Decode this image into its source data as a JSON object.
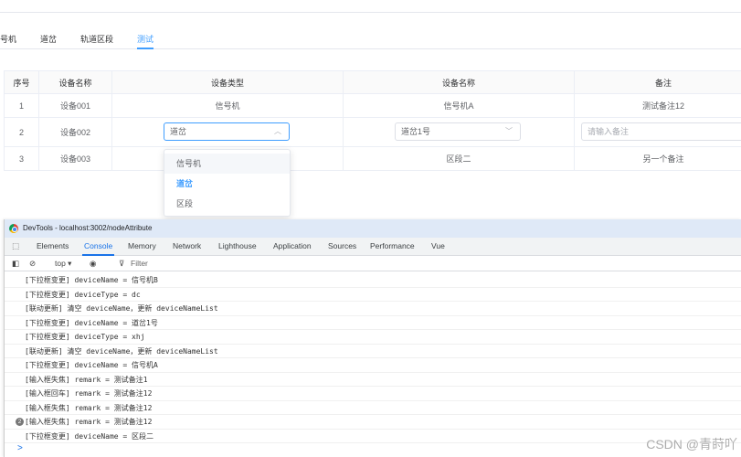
{
  "tabs": [
    "号机",
    "道岔",
    "轨道区段",
    "测试"
  ],
  "table": {
    "headers": [
      "序号",
      "设备名称",
      "设备类型",
      "设备名称",
      "备注"
    ],
    "rows": [
      {
        "index": "1",
        "name": "设备001",
        "type": "信号机",
        "device_name": "信号机A",
        "remark": "测试备注12"
      },
      {
        "index": "2",
        "name": "设备002",
        "type": "道岔",
        "device_name": "道岔1号",
        "remark_placeholder": "请输入备注"
      },
      {
        "index": "3",
        "name": "设备003",
        "type": "",
        "device_name": "区段二",
        "remark": "另一个备注"
      }
    ]
  },
  "dropdown": {
    "options": [
      "信号机",
      "道岔",
      "区段"
    ],
    "selected": "道岔"
  },
  "devtools": {
    "title": "DevTools - localhost:3002/nodeAttribute",
    "tabs": [
      "Elements",
      "Console",
      "Memory",
      "Network",
      "Lighthouse",
      "Application",
      "Sources",
      "Performance",
      "Vue"
    ],
    "active_tab": "Console",
    "context": "top ▾",
    "filter": "Filter",
    "logs": [
      "[下拉框变更] deviceName = 信号机B",
      "[下拉框变更] deviceType = dc",
      "[联动更新] 清空 deviceName，更新 deviceNameList",
      "[下拉框变更] deviceName = 道岔1号",
      "[下拉框变更] deviceType = xhj",
      "[联动更新] 清空 deviceName，更新 deviceNameList",
      "[下拉框变更] deviceName = 信号机A",
      "[输入框失焦] remark = 测试备注1",
      "[输入框回车] remark = 测试备注12",
      "[输入框失焦] remark = 测试备注12",
      "[输入框失焦] remark = 测试备注12",
      "[下拉框变更] deviceName = 区段二"
    ],
    "repeat_count": "2",
    "prompt": ">"
  },
  "watermark": "CSDN @青莳吖"
}
